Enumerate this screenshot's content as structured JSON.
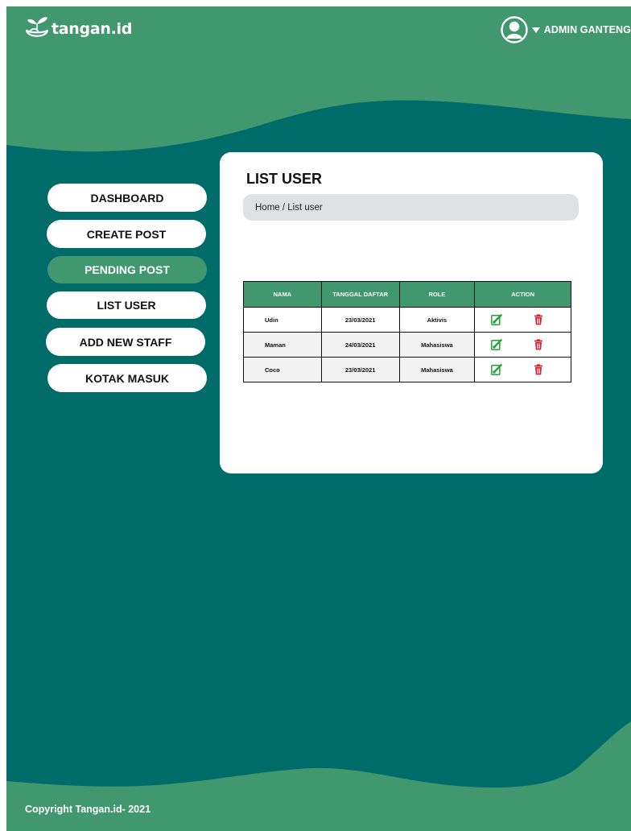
{
  "header": {
    "brand": "tangan.id",
    "user_name": "ADMIN GANTENG"
  },
  "sidebar": {
    "items": [
      {
        "label": "DASHBOARD"
      },
      {
        "label": "CREATE POST"
      },
      {
        "label": "PENDING POST",
        "active": true
      },
      {
        "label": "LIST USER"
      },
      {
        "label": "ADD NEW STAFF"
      },
      {
        "label": "KOTAK MASUK"
      }
    ]
  },
  "main": {
    "title": "LIST USER",
    "breadcrumb": "Home / List user",
    "table": {
      "columns": [
        "NAMA",
        "TANGGAL DAFTAR",
        "ROLE",
        "ACTION"
      ],
      "rows": [
        {
          "nama": "Udin",
          "tanggal": "23/03/2021",
          "role": "Aktivis",
          "actions": [
            "edit-icon",
            "trash-icon"
          ]
        },
        {
          "nama": "Maman",
          "tanggal": "24/03/2021",
          "role": "Mahasiswa",
          "actions": [
            "edit-icon",
            "trash-icon"
          ]
        },
        {
          "nama": "Coco",
          "tanggal": "23/03/2021",
          "role": "Mahasiswa",
          "actions": [
            "edit-icon",
            "trash-icon"
          ]
        }
      ]
    }
  },
  "footer": {
    "copyright": "Copyright Tangan.id- 2021"
  },
  "colors": {
    "primary_green": "#41976e",
    "dark_teal": "#006c6a",
    "edit_green": "#22a33a",
    "delete_red": "#d61f26"
  }
}
